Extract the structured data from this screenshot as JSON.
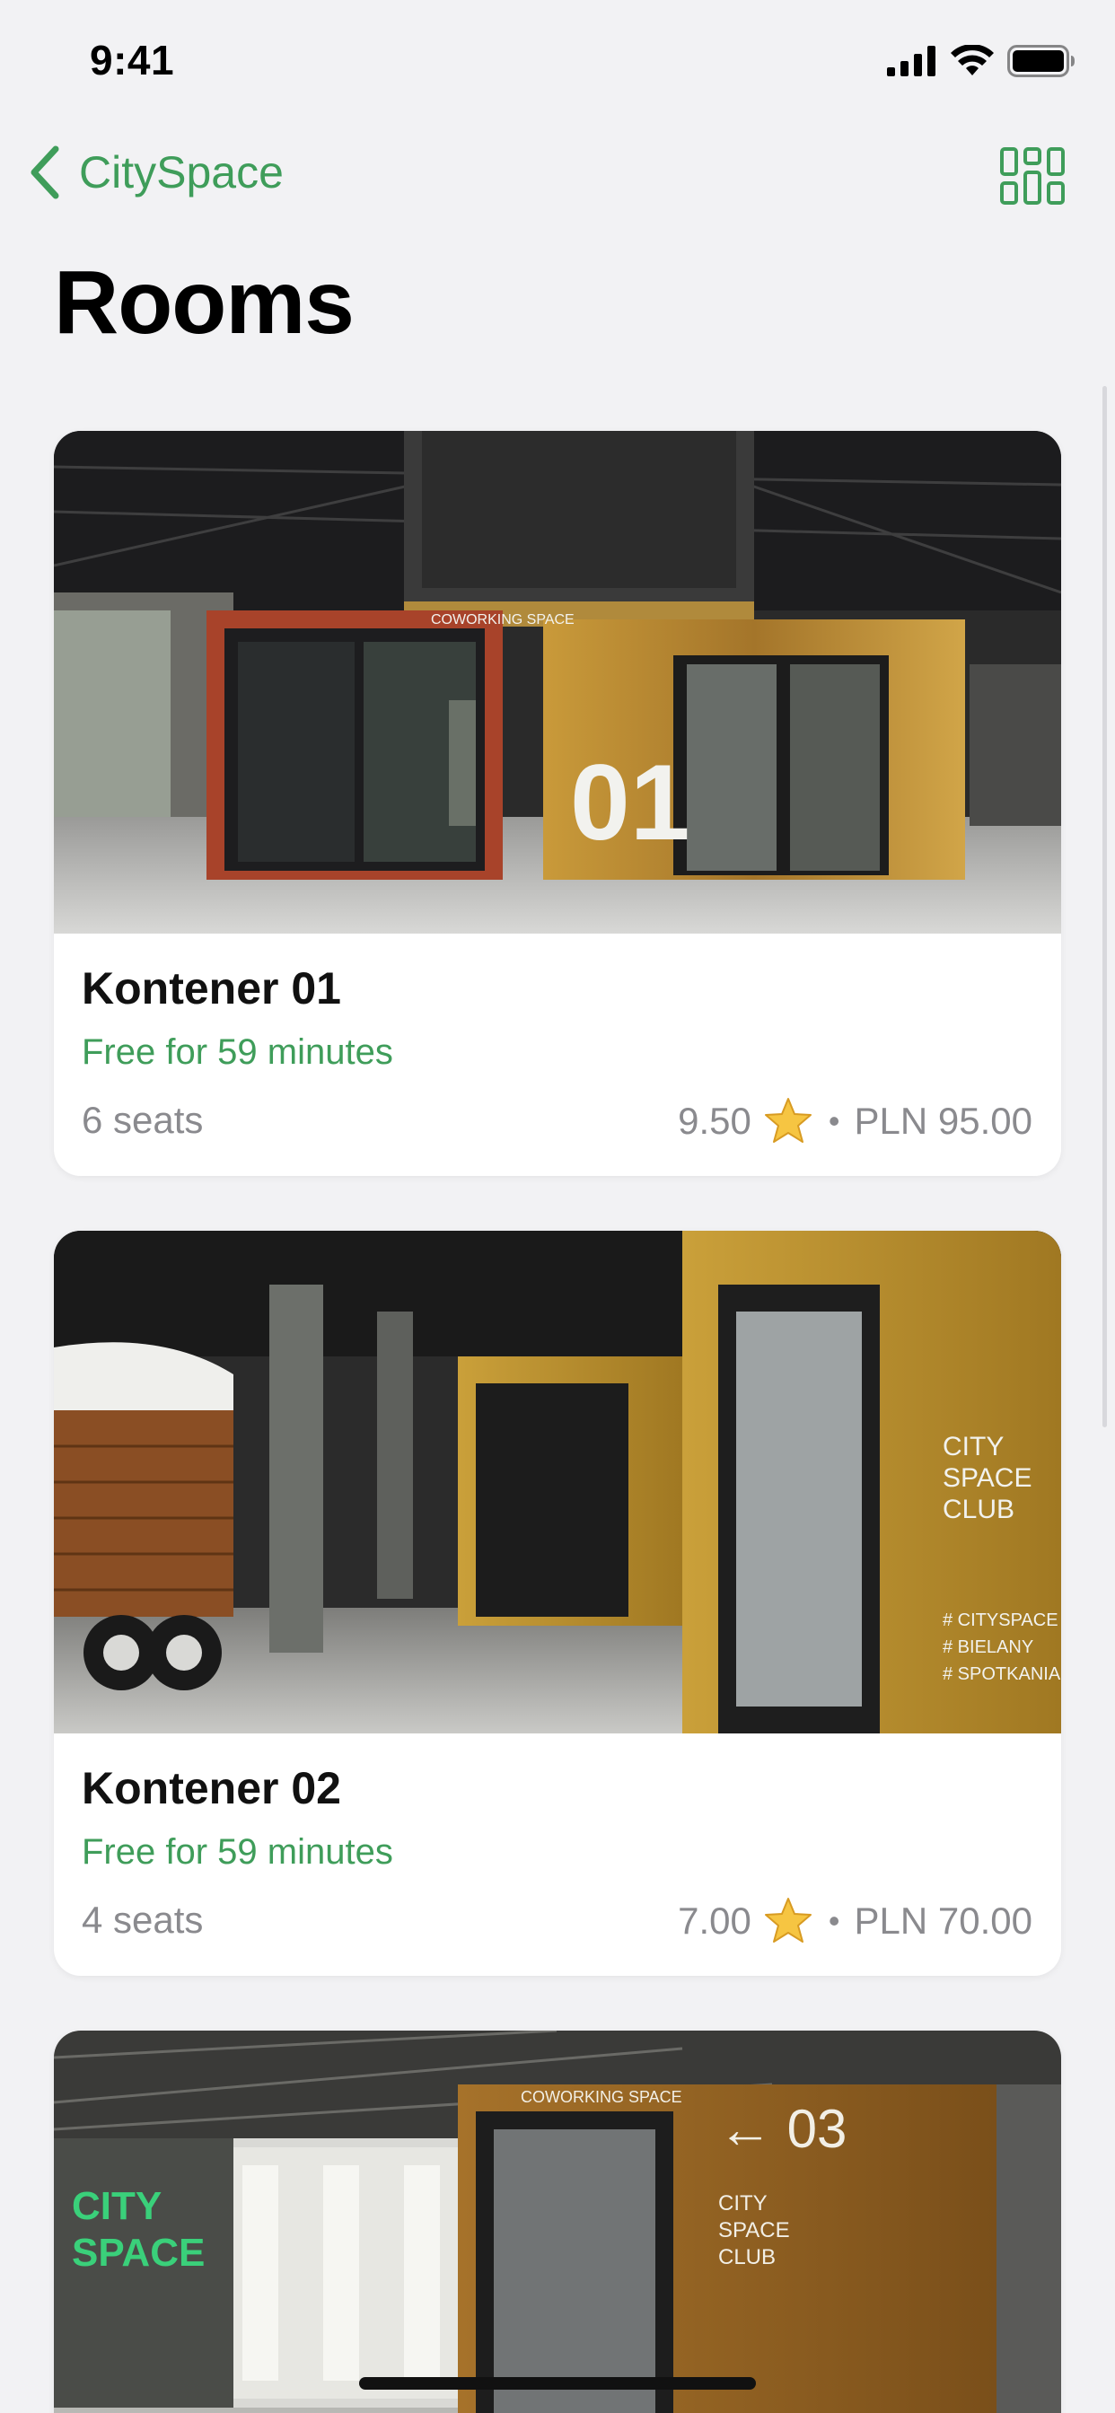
{
  "status_bar": {
    "time": "9:41"
  },
  "nav": {
    "back_label": "CitySpace",
    "grid_icon": "grid-view-icon"
  },
  "page": {
    "title": "Rooms"
  },
  "rooms": [
    {
      "name": "Kontener 01",
      "availability": "Free for 59 minutes",
      "seats": "6 seats",
      "rating": "9.50",
      "price": "PLN 95.00",
      "photo_text": "01"
    },
    {
      "name": "Kontener 02",
      "availability": "Free for 59 minutes",
      "seats": "4 seats",
      "rating": "7.00",
      "price": "PLN 70.00",
      "photo_text": "CITY SPACE CLUB"
    },
    {
      "name": "",
      "photo_text": "03"
    }
  ],
  "colors": {
    "accent": "#3f9d5a",
    "background": "#f2f2f4",
    "secondary_text": "#8a8a8e",
    "star": "#f6c542"
  },
  "separator": "•"
}
